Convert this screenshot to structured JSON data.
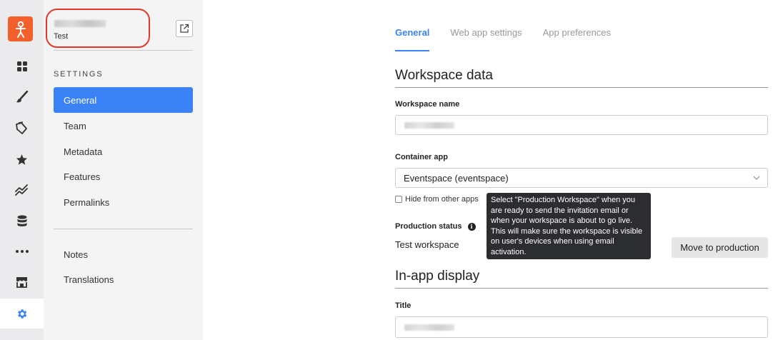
{
  "workspace": {
    "subtitle": "Test"
  },
  "rail": {
    "items": [
      {
        "icon": "dashboard-grid-icon"
      },
      {
        "icon": "brush-icon"
      },
      {
        "icon": "tags-icon"
      },
      {
        "icon": "star-icon"
      },
      {
        "icon": "analytics-icon"
      },
      {
        "icon": "database-icon"
      },
      {
        "icon": "more-icon"
      },
      {
        "icon": "store-icon"
      },
      {
        "icon": "settings-gear-icon",
        "active": true
      }
    ]
  },
  "sidebar": {
    "heading": "SETTINGS",
    "items": [
      {
        "label": "General",
        "active": true
      },
      {
        "label": "Team"
      },
      {
        "label": "Metadata"
      },
      {
        "label": "Features"
      },
      {
        "label": "Permalinks"
      }
    ],
    "secondary_items": [
      {
        "label": "Notes"
      },
      {
        "label": "Translations"
      }
    ]
  },
  "tabs": [
    {
      "label": "General",
      "active": true
    },
    {
      "label": "Web app settings"
    },
    {
      "label": "App preferences"
    }
  ],
  "workspace_data": {
    "section_title": "Workspace data",
    "workspace_name_label": "Workspace name",
    "container_app_label": "Container app",
    "container_app_value": "Eventspace (eventspace)",
    "hide_checkbox_label": "Hide from other apps",
    "hide_checked": false,
    "production_status_label": "Production status",
    "production_status_value": "Test workspace",
    "move_button_label": "Move to production",
    "tooltip_text": "Select \"Production Workspace\" when you are ready to send the invitation email or when your workspace is about to go live. This will make sure the workspace is visible on user's devices when using email activation."
  },
  "in_app_display": {
    "section_title": "In-app display",
    "title_label": "Title"
  },
  "colors": {
    "accent": "#3b82f6",
    "brand": "#f4602b",
    "highlight_circle": "#e0392b"
  }
}
